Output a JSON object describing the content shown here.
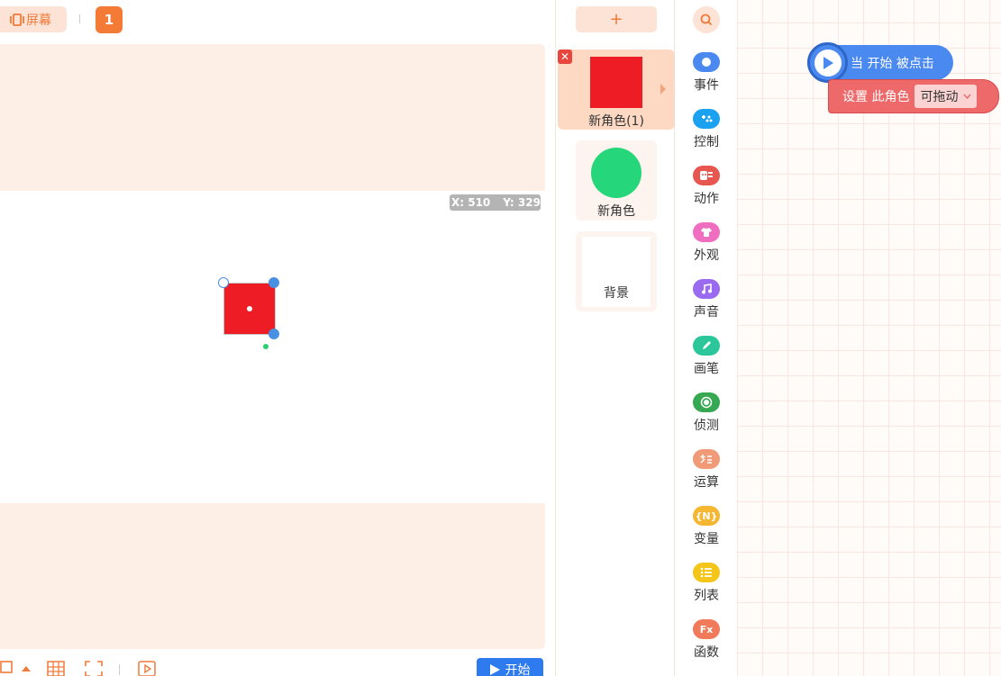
{
  "topbar": {
    "screen_label": "屏幕",
    "page_number": "1"
  },
  "stage": {
    "coord_x": "X: 510",
    "coord_y": "Y: 329"
  },
  "bottombar": {
    "start_label": "开始"
  },
  "sprites": {
    "add_label": "+",
    "items": [
      {
        "label": "新角色(1)",
        "shape": "square",
        "color": "#ee1c24",
        "selected": true
      },
      {
        "label": "新角色",
        "shape": "circle",
        "color": "#26d67a",
        "selected": false
      },
      {
        "label": "背景",
        "shape": "backdrop",
        "color": "#ffffff",
        "selected": false
      }
    ]
  },
  "categories": [
    {
      "label": "事件",
      "color": "#4a89f0",
      "icon": "circle-icon"
    },
    {
      "label": "控制",
      "color": "#1aa1f0",
      "icon": "gamepad-icon"
    },
    {
      "label": "动作",
      "color": "#e8574f",
      "icon": "robot-icon"
    },
    {
      "label": "外观",
      "color": "#f06ec0",
      "icon": "shirt-icon"
    },
    {
      "label": "声音",
      "color": "#9a6af0",
      "icon": "music-note-icon"
    },
    {
      "label": "画笔",
      "color": "#2bc79a",
      "icon": "pen-icon"
    },
    {
      "label": "侦测",
      "color": "#36a852",
      "icon": "target-icon"
    },
    {
      "label": "运算",
      "color": "#f09a78",
      "icon": "operators-icon"
    },
    {
      "label": "变量",
      "color": "#f5b731",
      "icon_text": "{N}",
      "icon": "variable-icon"
    },
    {
      "label": "列表",
      "color": "#f5c61a",
      "icon": "list-icon"
    },
    {
      "label": "函数",
      "color": "#f07a5a",
      "icon_text": "Fx",
      "icon": "function-icon"
    }
  ],
  "workspace": {
    "event_block": "当 开始 被点击",
    "set_block_label": "设置 此角色",
    "set_block_value": "可拖动"
  }
}
